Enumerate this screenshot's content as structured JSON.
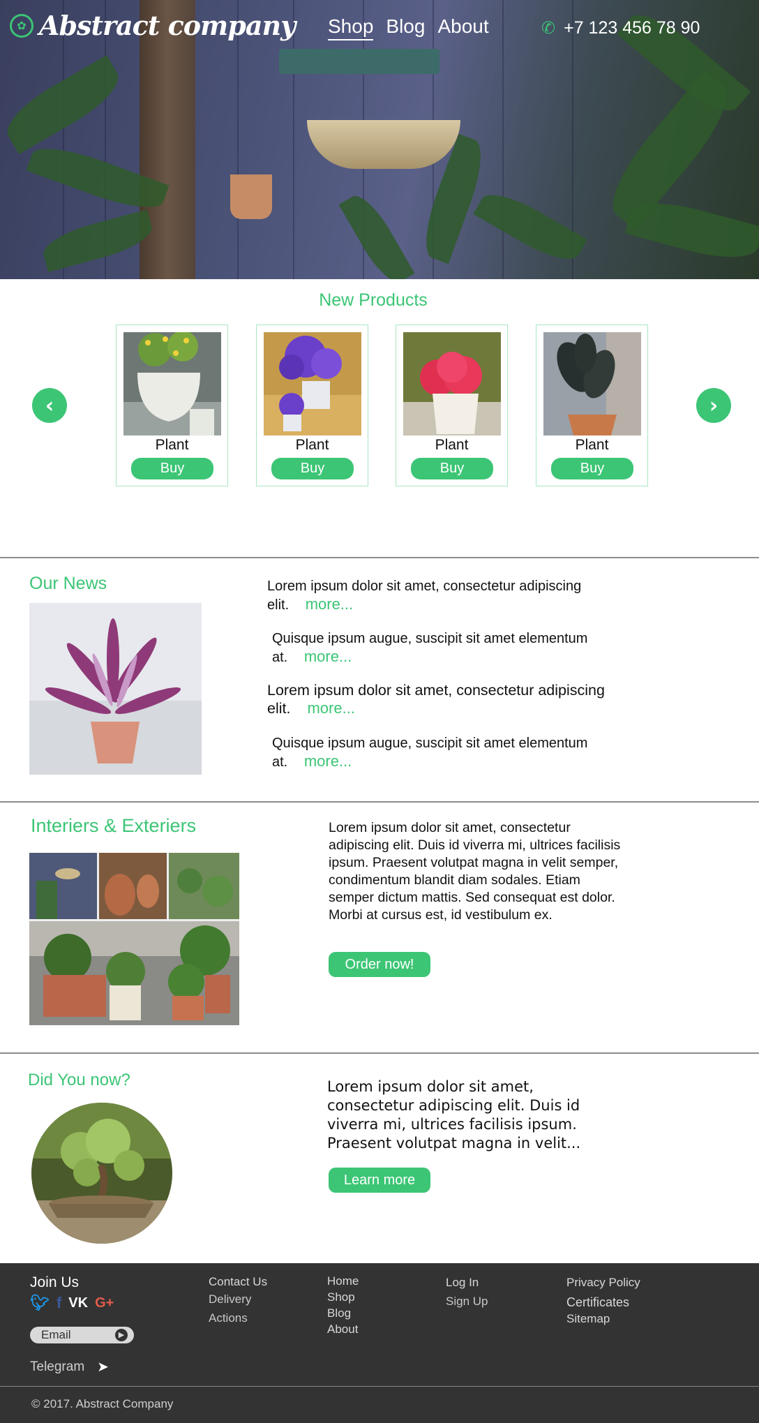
{
  "header": {
    "logo_text": "Abstract company",
    "nav": [
      "Shop",
      "Blog",
      "About"
    ],
    "phone": "+7 123 456 78 90"
  },
  "new_products": {
    "title": "New Products",
    "items": [
      {
        "name": "Plant",
        "buy": "Buy"
      },
      {
        "name": "Plant",
        "buy": "Buy"
      },
      {
        "name": "Plant",
        "buy": "Buy"
      },
      {
        "name": "Plant",
        "buy": "Buy"
      }
    ]
  },
  "news": {
    "title": "Our News",
    "items": [
      {
        "text": "Lorem ipsum dolor sit amet, consectetur adipiscing elit.",
        "more": "more..."
      },
      {
        "text": "Quisque ipsum augue, suscipit sit amet elementum at.",
        "more": "more..."
      },
      {
        "text": "Lorem ipsum dolor sit amet, consectetur adipiscing elit.",
        "more": "more..."
      },
      {
        "text": "Quisque ipsum augue, suscipit sit amet elementum at.",
        "more": "more..."
      }
    ]
  },
  "interiors": {
    "title": "Interiers & Exteriers",
    "text": "Lorem ipsum dolor sit amet, consectetur adipiscing elit. Duis id viverra mi, ultrices facilisis ipsum. Praesent volutpat magna in velit semper, condimentum blandit diam sodales. Etiam semper dictum mattis. Sed consequat est dolor. Morbi at cursus est, id vestibulum ex.",
    "button": "Order now!"
  },
  "did_you_know": {
    "title": "Did You now?",
    "text": "Lorem ipsum dolor sit amet, consectetur adipiscing elit. Duis id viverra mi, ultrices facilisis ipsum. Praesent volutpat magna in velit...",
    "button": "Learn more"
  },
  "footer": {
    "join": "Join Us",
    "email_placeholder": "Email",
    "telegram": "Telegram",
    "col1": [
      "Contact Us",
      "Delivery",
      "Actions"
    ],
    "col2": [
      "Home",
      "Shop",
      "Blog",
      "About"
    ],
    "col3": [
      "Log In",
      "Sign Up"
    ],
    "col4": [
      "Privacy Policy",
      "Certificates",
      "Sitemap"
    ],
    "copyright": "©  2017. Abstract Company"
  },
  "colors": {
    "accent": "#3cc575",
    "footer_bg": "#333333"
  },
  "icons": [
    "leaf-logo-icon",
    "phone-icon",
    "chevron-left-icon",
    "chevron-right-icon",
    "twitter-icon",
    "facebook-icon",
    "vk-icon",
    "google-plus-icon",
    "arrow-right-icon",
    "paper-plane-icon"
  ]
}
